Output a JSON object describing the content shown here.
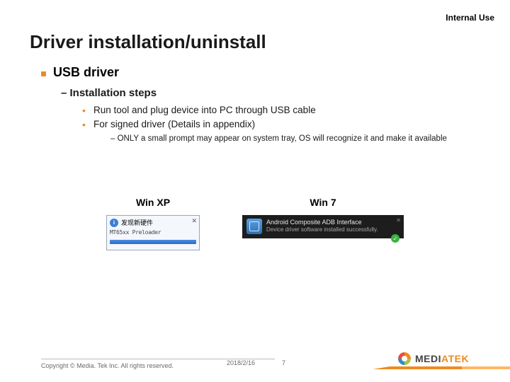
{
  "classification": "Internal Use",
  "title": "Driver installation/uninstall",
  "lvl1": "USB driver",
  "lvl2": "–  Installation steps",
  "lvl3": {
    "a": "Run tool and plug device into PC through USB cable",
    "b": "For signed driver (Details in appendix)"
  },
  "lvl4": "–  ONLY a small prompt may appear on system tray, OS will recognize it and make it available",
  "screenshots": {
    "xp": {
      "label": "Win XP",
      "bubble_title": "发现新硬件",
      "bubble_sub": "MT65xx Preloader"
    },
    "win7": {
      "label": "Win 7",
      "line1": "Android Composite ADB Interface",
      "line2": "Device driver software installed successfully."
    }
  },
  "footer": {
    "copyright": "Copyright © Media. Tek Inc. All rights reserved.",
    "date": "2018/2/16",
    "page": "7",
    "brand1": "MEDI",
    "brand2": "ATEK"
  }
}
